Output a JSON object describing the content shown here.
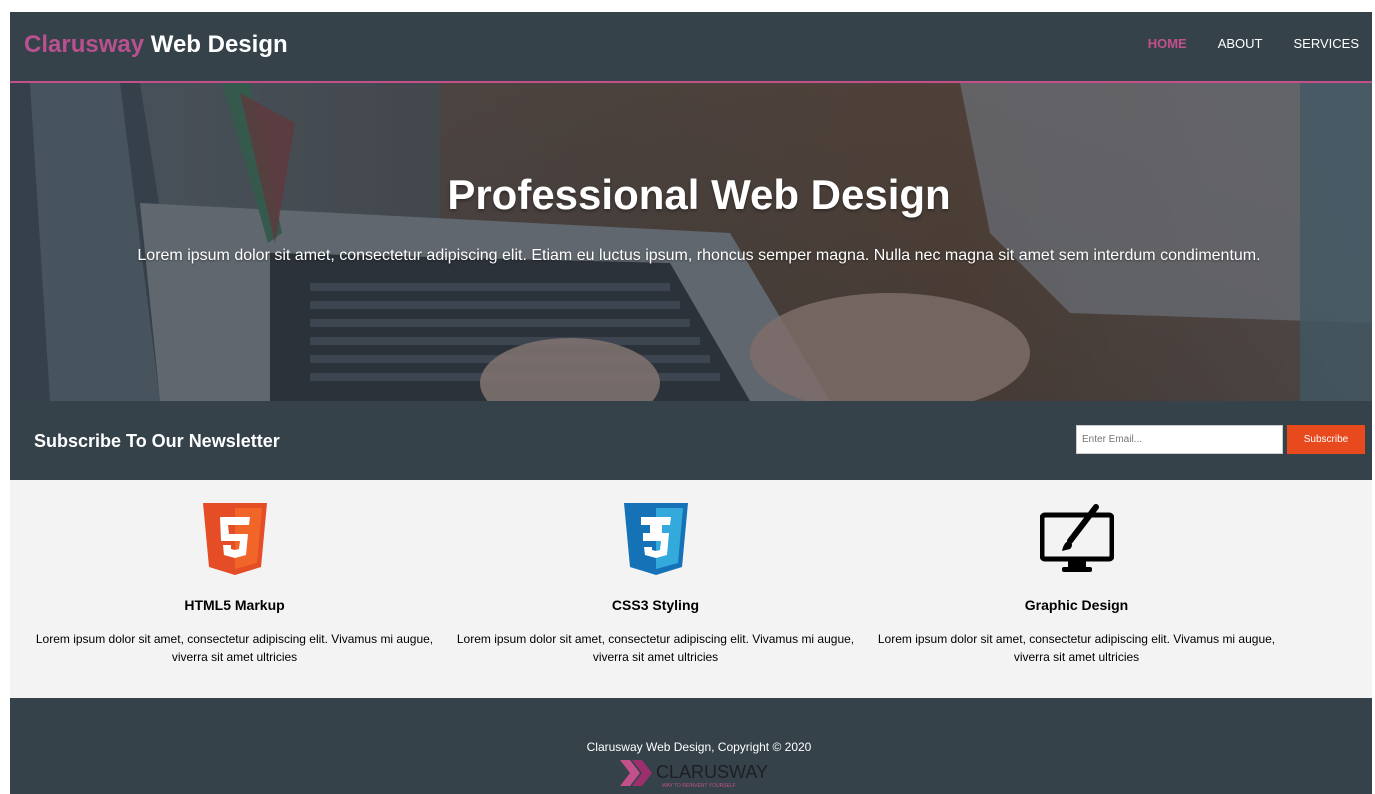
{
  "header": {
    "logo_highlight": "Clarusway",
    "logo_rest": "Web Design",
    "nav": [
      {
        "label": "HOME",
        "active": true
      },
      {
        "label": "ABOUT",
        "active": false
      },
      {
        "label": "SERVICES",
        "active": false
      }
    ]
  },
  "hero": {
    "title": "Professional Web Design",
    "text": "Lorem ipsum dolor sit amet, consectetur adipiscing elit. Etiam eu luctus ipsum, rhoncus semper magna. Nulla nec magna sit amet sem interdum condimentum."
  },
  "newsletter": {
    "heading": "Subscribe To Our Newsletter",
    "email_placeholder": "Enter Email...",
    "button_label": "Subscribe"
  },
  "boxes": [
    {
      "icon": "html5-icon",
      "title": "HTML5 Markup",
      "text": "Lorem ipsum dolor sit amet, consectetur adipiscing elit. Vivamus mi augue, viverra sit amet ultricies"
    },
    {
      "icon": "css3-icon",
      "title": "CSS3 Styling",
      "text": "Lorem ipsum dolor sit amet, consectetur adipiscing elit. Vivamus mi augue, viverra sit amet ultricies"
    },
    {
      "icon": "graphic-design-icon",
      "title": "Graphic Design",
      "text": "Lorem ipsum dolor sit amet, consectetur adipiscing elit. Vivamus mi augue, viverra sit amet ultricies"
    }
  ],
  "footer": {
    "copyright": "Clarusway Web Design, Copyright © 2020",
    "brand_name": "CLARUSWAY",
    "brand_tagline": "WAY TO REINVENT YOURSELF"
  },
  "colors": {
    "dark": "#35424a",
    "accent": "#c2508a",
    "button": "#e8491d",
    "light_bg": "#f3f3f3"
  }
}
